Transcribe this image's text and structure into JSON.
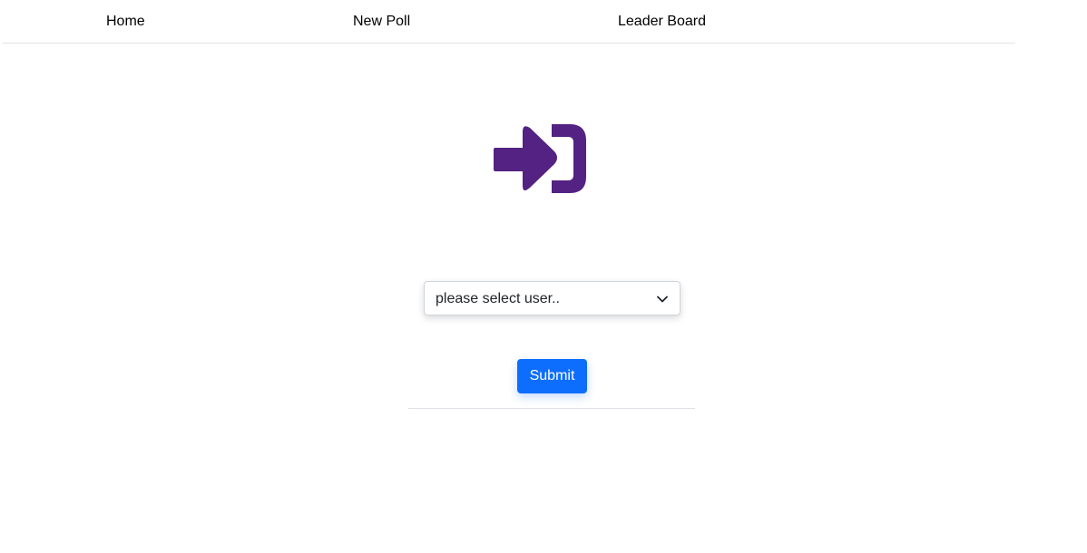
{
  "nav": {
    "items": [
      {
        "label": "Home"
      },
      {
        "label": "New Poll"
      },
      {
        "label": "Leader Board"
      }
    ]
  },
  "login": {
    "icon": "sign-in-icon",
    "icon_color": "#532282",
    "select": {
      "selected": "please select user.."
    },
    "submit_label": "Submit",
    "submit_color": "#0d6efd"
  }
}
